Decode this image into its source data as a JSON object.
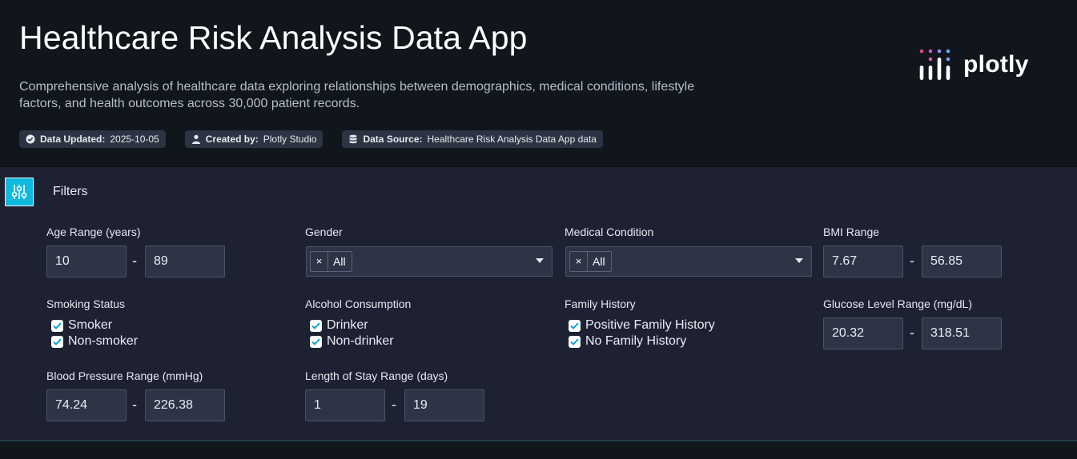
{
  "header": {
    "title": "Healthcare Risk Analysis Data App",
    "subtitle": "Comprehensive analysis of healthcare data exploring relationships between demographics, medical conditions, lifestyle factors, and health outcomes across 30,000 patient records.",
    "badges": [
      {
        "icon": "check-circle-icon",
        "label": "Data Updated:",
        "value": "2025-10-05"
      },
      {
        "icon": "user-icon",
        "label": "Created by:",
        "value": "Plotly Studio"
      },
      {
        "icon": "database-icon",
        "label": "Data Source:",
        "value": "Healthcare Risk Analysis Data App data"
      }
    ],
    "logo_text": "plotly"
  },
  "filters": {
    "title": "Filters",
    "age": {
      "label": "Age Range (years)",
      "min": "10",
      "max": "89"
    },
    "gender": {
      "label": "Gender",
      "value": "All"
    },
    "condition": {
      "label": "Medical Condition",
      "value": "All"
    },
    "bmi": {
      "label": "BMI Range",
      "min": "7.67",
      "max": "56.85"
    },
    "smoking": {
      "label": "Smoking Status",
      "options": [
        "Smoker",
        "Non-smoker"
      ]
    },
    "alcohol": {
      "label": "Alcohol Consumption",
      "options": [
        "Drinker",
        "Non-drinker"
      ]
    },
    "family": {
      "label": "Family History",
      "options": [
        "Positive Family History",
        "No Family History"
      ]
    },
    "glucose": {
      "label": "Glucose Level Range (mg/dL)",
      "min": "20.32",
      "max": "318.51"
    },
    "bp": {
      "label": "Blood Pressure Range (mmHg)",
      "min": "74.24",
      "max": "226.38"
    },
    "stay": {
      "label": "Length of Stay Range (days)",
      "min": "1",
      "max": "19"
    },
    "range_sep": "-",
    "clear_symbol": "×"
  },
  "colors": {
    "background": "#11151c",
    "panel": "#1d2132",
    "accent": "#0fb8dd",
    "input": "#2d3446"
  }
}
